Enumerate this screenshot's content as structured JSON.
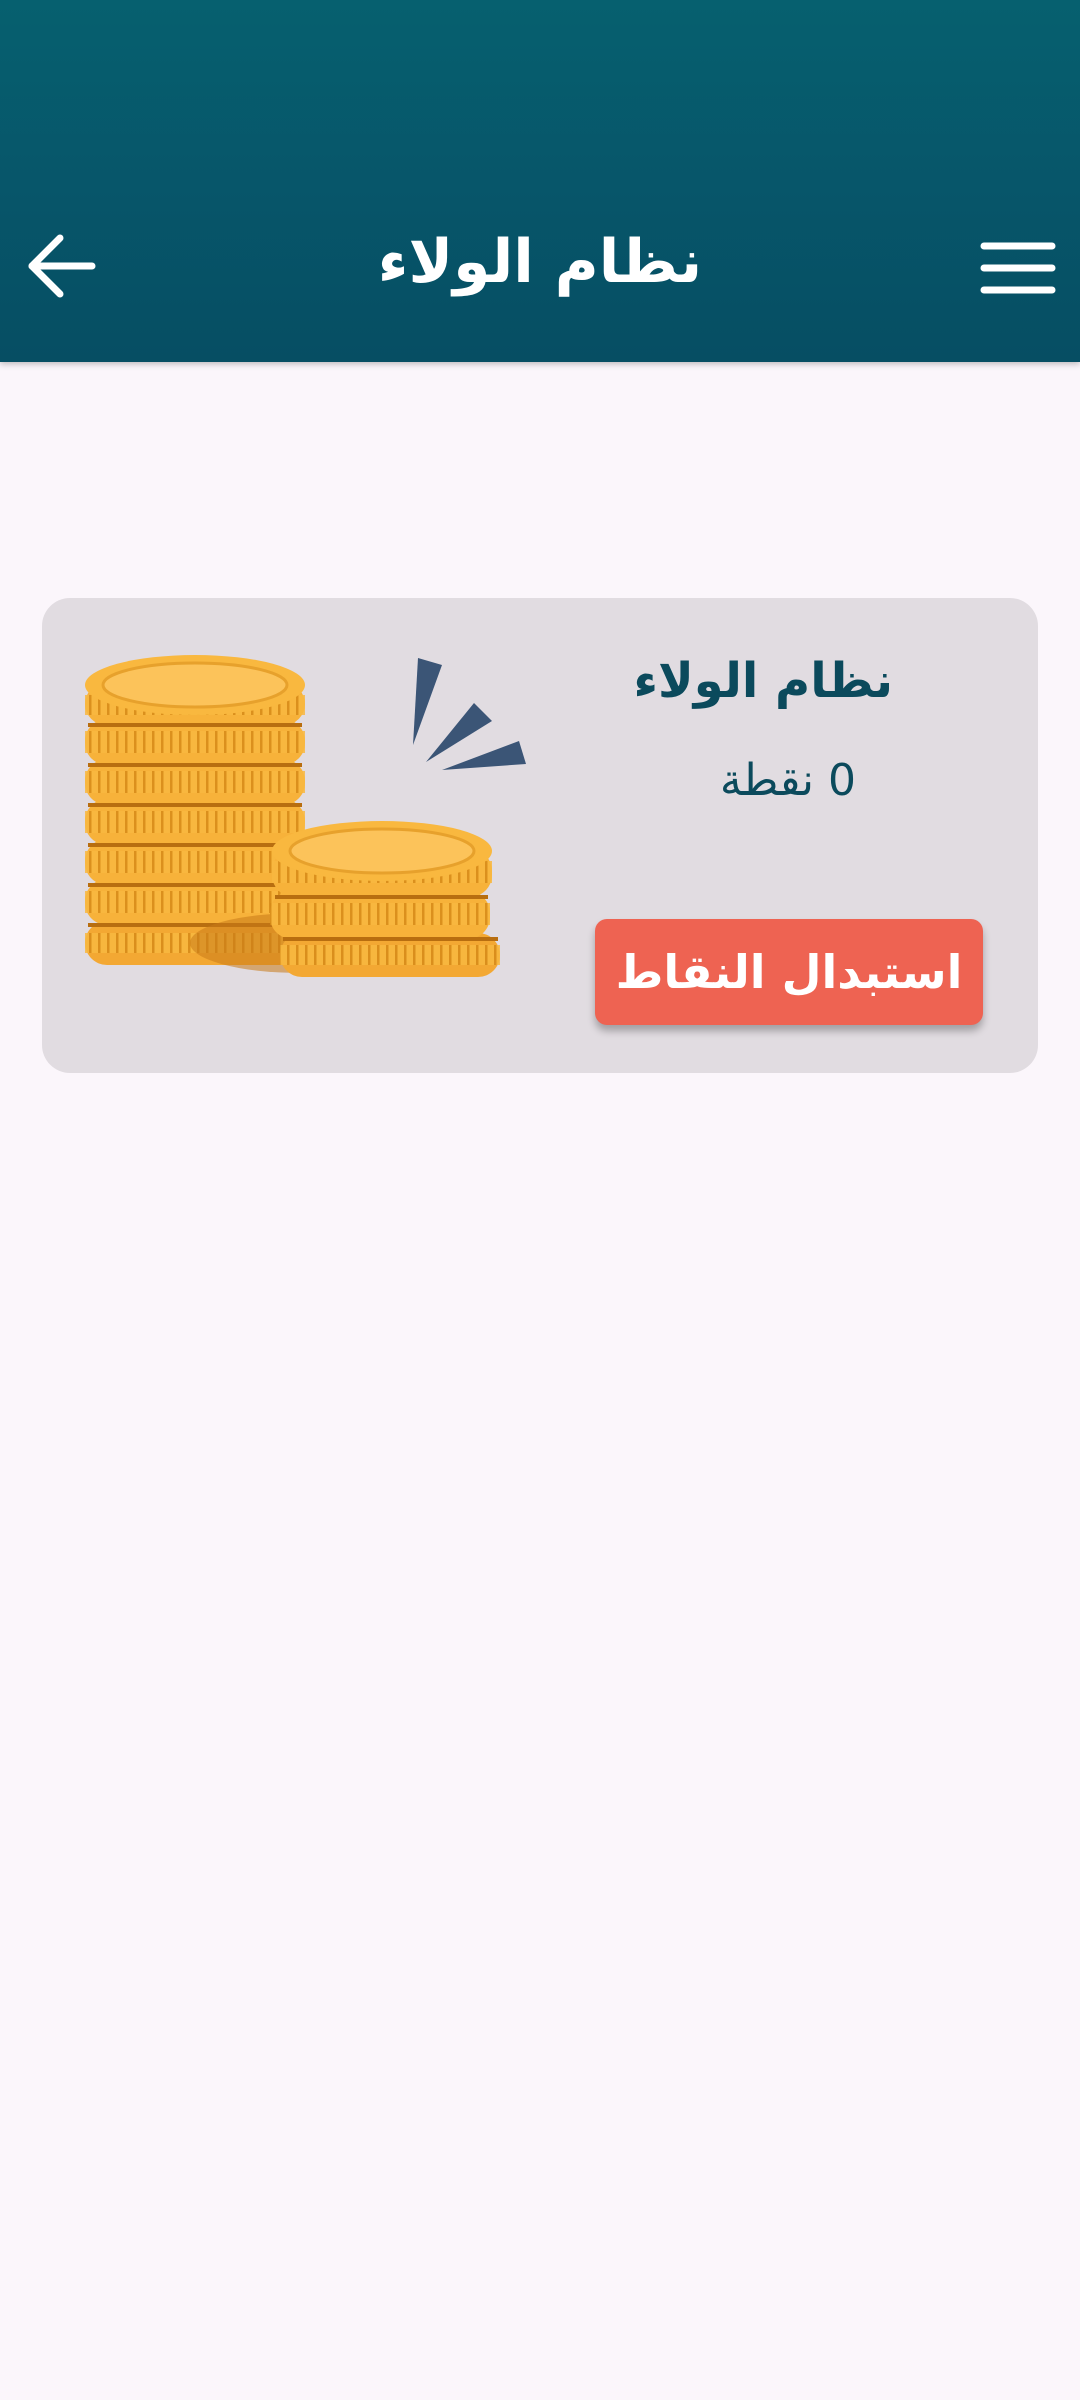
{
  "header": {
    "title": "نظام الولاء",
    "back_icon": "arrow-back-icon",
    "menu_icon": "hamburger-menu-icon",
    "background_colors": [
      "#06606f",
      "#064e63"
    ],
    "title_color": "#ffffff"
  },
  "loyalty_card": {
    "title": "نظام الولاء",
    "points_value": "0",
    "points_unit": "نقطة",
    "redeem_label": "استبدال النقاط",
    "illustration": "gold-coins-stack-icon",
    "card_color": "#e1dce1",
    "text_color": "#0b4a5c",
    "button_color": "#ee6352"
  },
  "page": {
    "background_color": "#fbf6fb"
  }
}
